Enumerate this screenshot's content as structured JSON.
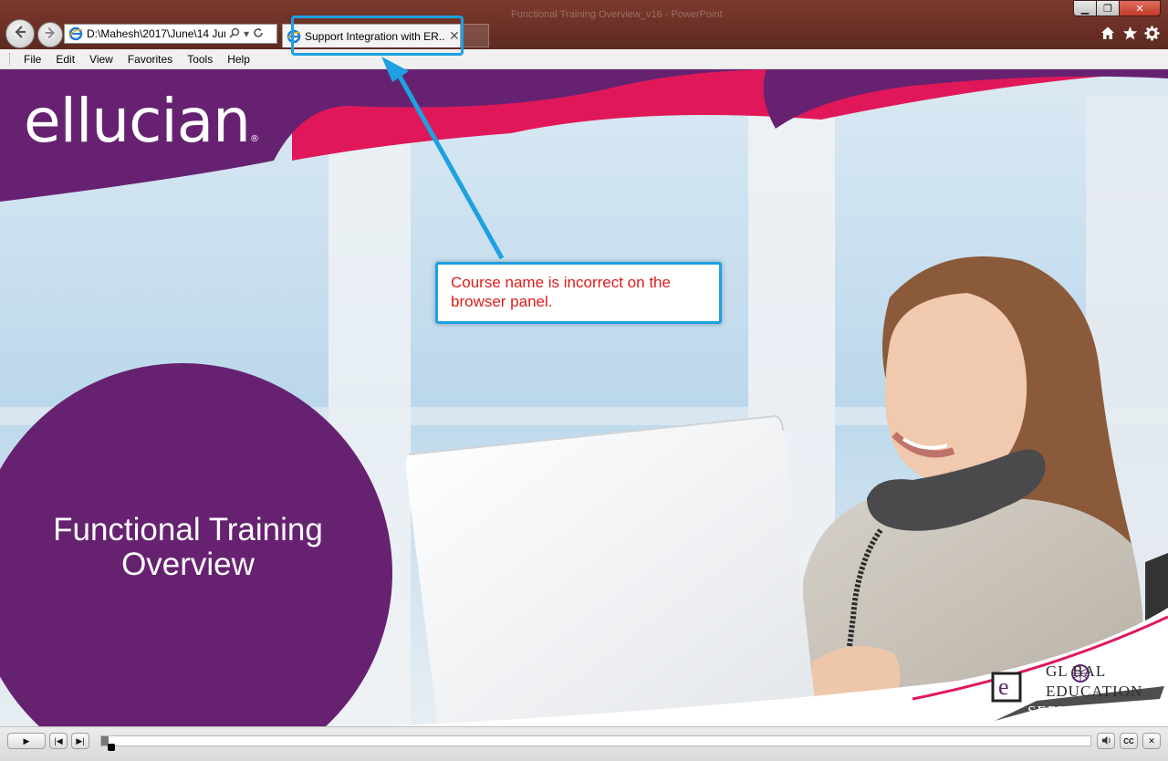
{
  "browser": {
    "address": "D:\\Mahesh\\2017\\June\\14 Jur",
    "tab_title": "Support Integration with ER...",
    "tab_close": "✕",
    "background_title": "Functional Training Overview_v16 - PowerPoint",
    "menu": [
      "File",
      "Edit",
      "View",
      "Favorites",
      "Tools",
      "Help"
    ],
    "icons": {
      "back": "back-arrow-icon",
      "forward": "forward-arrow-icon",
      "search": "search-icon",
      "refresh": "refresh-icon",
      "home": "home-icon",
      "favorites": "star-icon",
      "tools": "gear-icon"
    },
    "window_controls": {
      "minimize": "▁",
      "maximize": "❐",
      "close": "✕"
    }
  },
  "slide": {
    "brand": "ellucian",
    "brand_mark": "®",
    "title_line1": "Functional Training",
    "title_line2": "Overview",
    "footer_logo": {
      "letter": "e",
      "line1": "GL  BAL",
      "line2": "EDUCATION",
      "line3": "SERVICES"
    },
    "colors": {
      "purple": "#662270",
      "pink": "#e0185a",
      "sky": "#cfe4f1"
    }
  },
  "annotation": {
    "text_line1": "Course name is incorrect on the",
    "text_line2": "browser panel.",
    "color": "#e01b1b",
    "border": "#1da1e2"
  },
  "player": {
    "play": "▶",
    "rewind": "|◀",
    "next": "▶|",
    "volume": "🔊",
    "cc": "CC",
    "close": "✕",
    "progress": 0.007
  }
}
